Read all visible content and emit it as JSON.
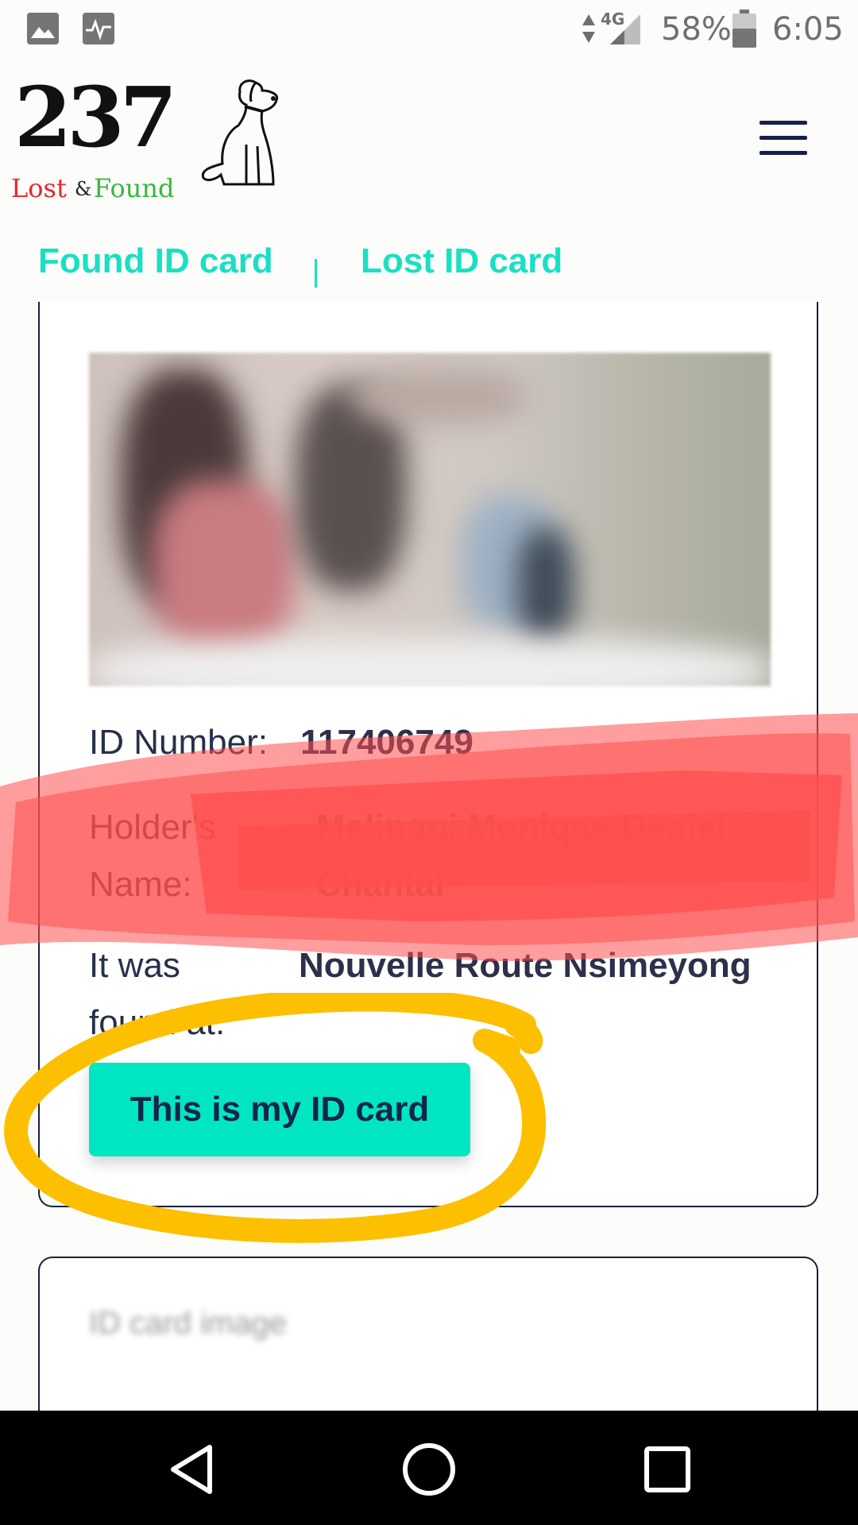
{
  "status_bar": {
    "network_type": "4G",
    "battery_percent": "58%",
    "time": "6:05",
    "icons": [
      "image-icon",
      "activity-icon",
      "data-arrows-icon",
      "signal-icon",
      "battery-icon"
    ]
  },
  "header": {
    "logo": {
      "number": "237",
      "lost": "Lost",
      "amp": "&",
      "found": "Found",
      "mascot_icon": "dog-icon"
    },
    "menu_icon": "hamburger-menu-icon"
  },
  "tabs": [
    {
      "label": "Found ID card"
    },
    {
      "label": "Lost ID card"
    }
  ],
  "card": {
    "id_number_label": "ID Number:",
    "id_number_value": "117406749",
    "holder_label": "Holder's Name:",
    "holder_value": "Melingui Monique Daniel Chantal",
    "found_label": "It was found at:",
    "found_value": "Nouvelle Route Nsimeyong",
    "claim_button_label": "This is my ID card"
  },
  "card2": {
    "image_alt": "ID card image"
  },
  "nav_bar": {
    "icons": [
      "back-icon",
      "home-icon",
      "recents-icon"
    ]
  },
  "colors": {
    "accent": "#00e6c3",
    "tab_text": "#19e0c2",
    "dark_navy": "#14254a",
    "logo_red": "#e8262b",
    "logo_green": "#36b83a",
    "redaction": "#ff4f4f",
    "highlight": "#fcc000"
  }
}
